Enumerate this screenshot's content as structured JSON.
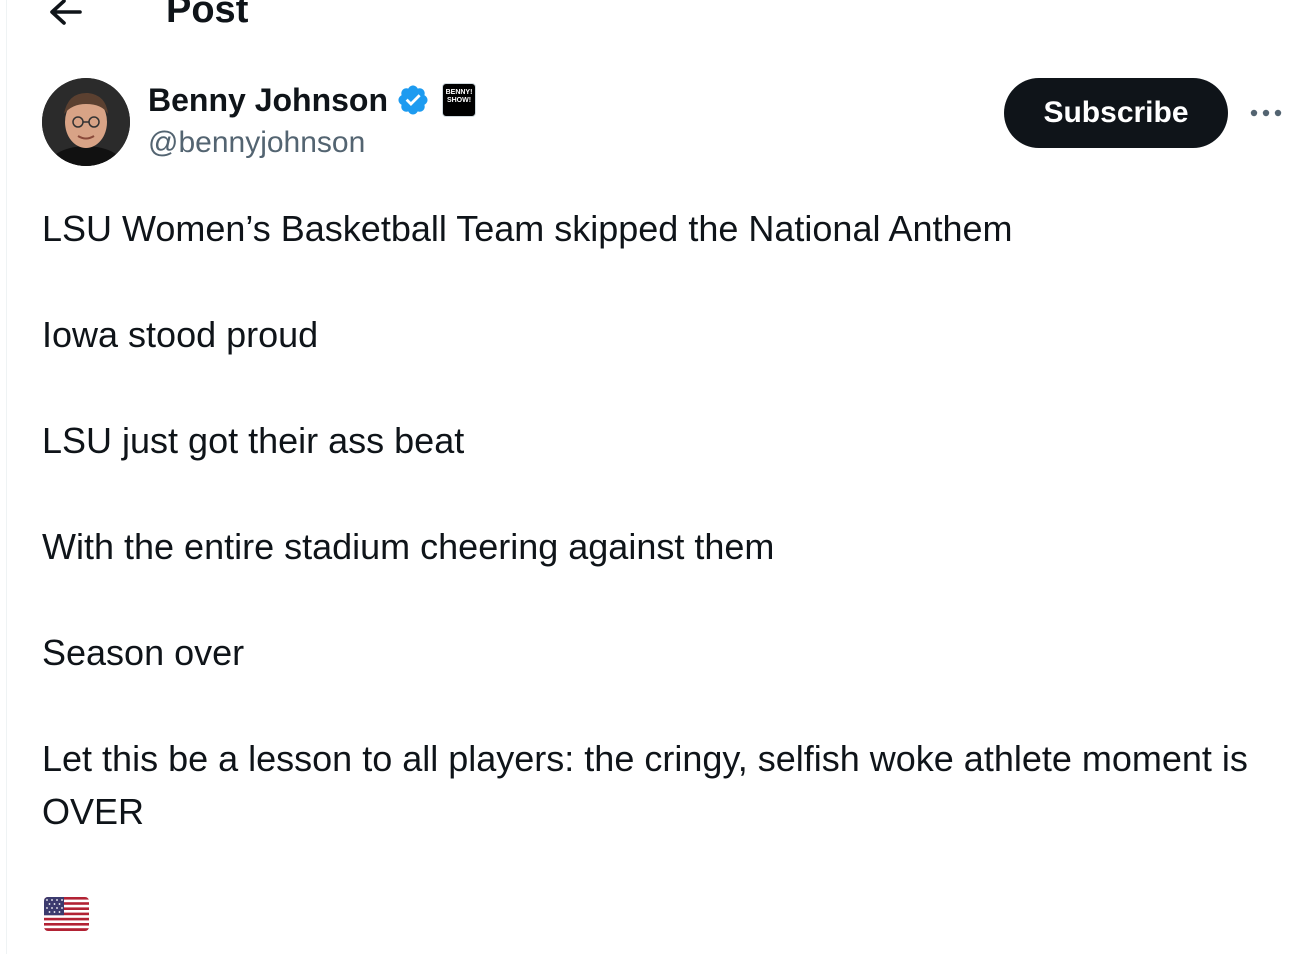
{
  "header": {
    "title": "Post",
    "back_icon": "arrow-left-icon"
  },
  "author": {
    "display_name": "Benny Johnson",
    "handle": "@bennyjohnson",
    "verified_icon": "verified-badge-icon",
    "verified_color": "#1d9bf0",
    "affiliate_badge_text": "BENNY! SHOW!"
  },
  "actions": {
    "subscribe_label": "Subscribe",
    "more_icon": "more-options-icon"
  },
  "tweet": {
    "paragraphs": [
      "LSU Women’s Basketball Team skipped the National Anthem",
      "Iowa stood proud",
      "LSU just got their ass beat",
      "With the entire stadium cheering against them",
      "Season over",
      "Let this be a lesson to all players: the cringy, selfish woke athlete moment is OVER"
    ],
    "emoji": "us-flag-emoji"
  },
  "colors": {
    "text": "#0f1419",
    "secondary": "#536471",
    "button_bg": "#0f1419"
  }
}
